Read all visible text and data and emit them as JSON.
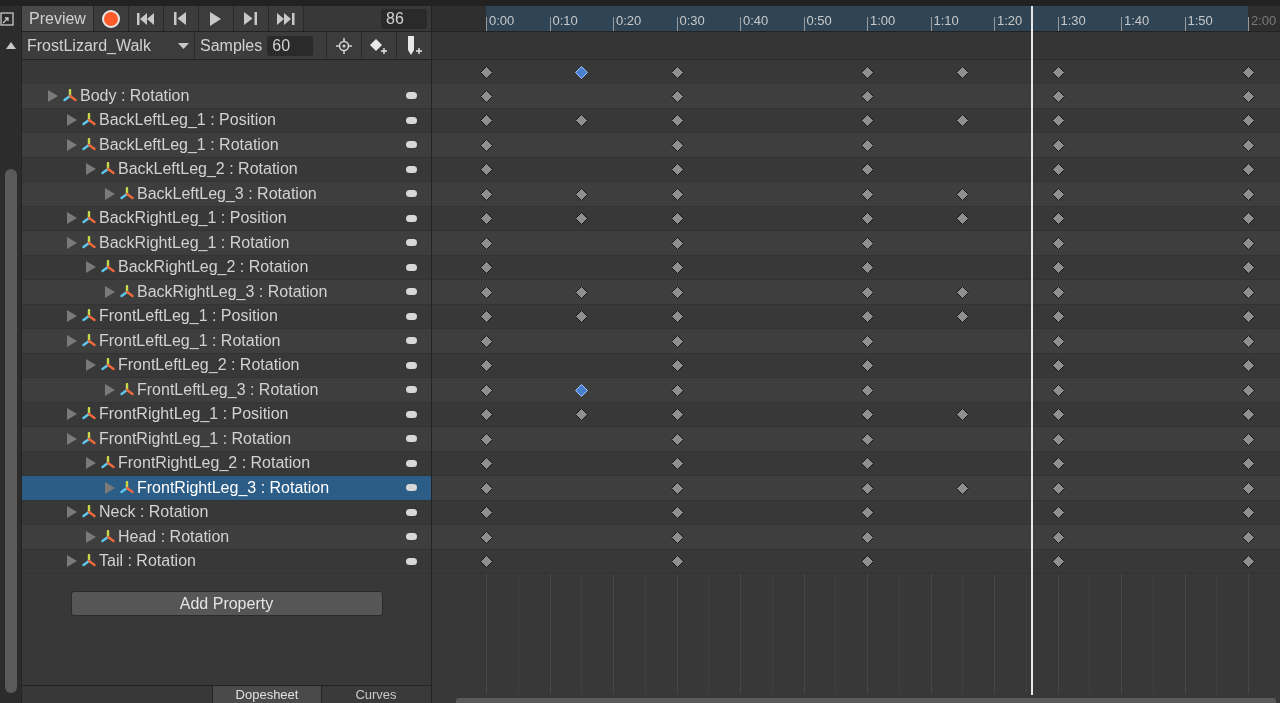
{
  "toolbar": {
    "preview": {
      "label": "Preview",
      "on": false
    },
    "record": {
      "on": false
    },
    "frame": "86"
  },
  "clip": {
    "name": "FrostLizard_Walk",
    "samples_label": "Samples",
    "samples": "60"
  },
  "ruler": [
    {
      "label": "0:00",
      "dimmed": false
    },
    {
      "label": "0:10",
      "dimmed": false
    },
    {
      "label": "0:20",
      "dimmed": false
    },
    {
      "label": "0:30",
      "dimmed": false
    },
    {
      "label": "0:40",
      "dimmed": false
    },
    {
      "label": "0:50",
      "dimmed": false
    },
    {
      "label": "1:00",
      "dimmed": false
    },
    {
      "label": "1:10",
      "dimmed": false
    },
    {
      "label": "1:20",
      "dimmed": false
    },
    {
      "label": "1:30",
      "dimmed": false
    },
    {
      "label": "1:40",
      "dimmed": false
    },
    {
      "label": "1:50",
      "dimmed": false
    },
    {
      "label": "2:00",
      "dimmed": true
    }
  ],
  "summary_keys": [
    {
      "keyed": true,
      "selected": false
    },
    {
      "keyed": true,
      "selected": true
    },
    {
      "keyed": true,
      "selected": false
    },
    {
      "keyed": true,
      "selected": false
    },
    {
      "keyed": true,
      "selected": false
    },
    {
      "keyed": true,
      "selected": false
    },
    {
      "keyed": true,
      "selected": false
    }
  ],
  "properties": [
    {
      "label": "Body : Rotation",
      "selected": false,
      "keys": [
        {
          "keyed": true,
          "selected": false
        },
        {
          "keyed": false
        },
        {
          "keyed": true,
          "selected": false
        },
        {
          "keyed": true,
          "selected": false
        },
        {
          "keyed": false
        },
        {
          "keyed": true,
          "selected": false
        },
        {
          "keyed": true,
          "selected": false
        }
      ],
      "children": [
        {
          "label": "BackLeftLeg_1 : Position",
          "selected": false,
          "keys": [
            {
              "keyed": true,
              "selected": false
            },
            {
              "keyed": true,
              "selected": false
            },
            {
              "keyed": true,
              "selected": false
            },
            {
              "keyed": true,
              "selected": false
            },
            {
              "keyed": true,
              "selected": false
            },
            {
              "keyed": true,
              "selected": false
            },
            {
              "keyed": true,
              "selected": false
            }
          ]
        },
        {
          "label": "BackLeftLeg_1 : Rotation",
          "selected": false,
          "keys": [
            {
              "keyed": true,
              "selected": false
            },
            {
              "keyed": false
            },
            {
              "keyed": true,
              "selected": false
            },
            {
              "keyed": true,
              "selected": false
            },
            {
              "keyed": false
            },
            {
              "keyed": true,
              "selected": false
            },
            {
              "keyed": true,
              "selected": false
            }
          ],
          "children": [
            {
              "label": "BackLeftLeg_2 : Rotation",
              "selected": false,
              "keys": [
                {
                  "keyed": true,
                  "selected": false
                },
                {
                  "keyed": false
                },
                {
                  "keyed": true,
                  "selected": false
                },
                {
                  "keyed": true,
                  "selected": false
                },
                {
                  "keyed": false
                },
                {
                  "keyed": true,
                  "selected": false
                },
                {
                  "keyed": true,
                  "selected": false
                }
              ],
              "children": [
                {
                  "label": "BackLeftLeg_3 : Rotation",
                  "selected": false,
                  "keys": [
                    {
                      "keyed": true,
                      "selected": false
                    },
                    {
                      "keyed": true,
                      "selected": false
                    },
                    {
                      "keyed": true,
                      "selected": false
                    },
                    {
                      "keyed": true,
                      "selected": false
                    },
                    {
                      "keyed": true,
                      "selected": false
                    },
                    {
                      "keyed": true,
                      "selected": false
                    },
                    {
                      "keyed": true,
                      "selected": false
                    }
                  ]
                }
              ]
            }
          ]
        },
        {
          "label": "BackRightLeg_1 : Position",
          "selected": false,
          "keys": [
            {
              "keyed": true,
              "selected": false
            },
            {
              "keyed": true,
              "selected": false
            },
            {
              "keyed": true,
              "selected": false
            },
            {
              "keyed": true,
              "selected": false
            },
            {
              "keyed": true,
              "selected": false
            },
            {
              "keyed": true,
              "selected": false
            },
            {
              "keyed": true,
              "selected": false
            }
          ]
        },
        {
          "label": "BackRightLeg_1 : Rotation",
          "selected": false,
          "keys": [
            {
              "keyed": true,
              "selected": false
            },
            {
              "keyed": false
            },
            {
              "keyed": true,
              "selected": false
            },
            {
              "keyed": true,
              "selected": false
            },
            {
              "keyed": false
            },
            {
              "keyed": true,
              "selected": false
            },
            {
              "keyed": true,
              "selected": false
            }
          ],
          "children": [
            {
              "label": "BackRightLeg_2 : Rotation",
              "selected": false,
              "keys": [
                {
                  "keyed": true,
                  "selected": false
                },
                {
                  "keyed": false
                },
                {
                  "keyed": true,
                  "selected": false
                },
                {
                  "keyed": true,
                  "selected": false
                },
                {
                  "keyed": false
                },
                {
                  "keyed": true,
                  "selected": false
                },
                {
                  "keyed": true,
                  "selected": false
                }
              ],
              "children": [
                {
                  "label": "BackRightLeg_3 : Rotation",
                  "selected": false,
                  "keys": [
                    {
                      "keyed": true,
                      "selected": false
                    },
                    {
                      "keyed": true,
                      "selected": false
                    },
                    {
                      "keyed": true,
                      "selected": false
                    },
                    {
                      "keyed": true,
                      "selected": false
                    },
                    {
                      "keyed": true,
                      "selected": false
                    },
                    {
                      "keyed": true,
                      "selected": false
                    },
                    {
                      "keyed": true,
                      "selected": false
                    }
                  ]
                }
              ]
            }
          ]
        },
        {
          "label": "FrontLeftLeg_1 : Position",
          "selected": false,
          "keys": [
            {
              "keyed": true,
              "selected": false
            },
            {
              "keyed": true,
              "selected": false
            },
            {
              "keyed": true,
              "selected": false
            },
            {
              "keyed": true,
              "selected": false
            },
            {
              "keyed": true,
              "selected": false
            },
            {
              "keyed": true,
              "selected": false
            },
            {
              "keyed": true,
              "selected": false
            }
          ]
        },
        {
          "label": "FrontLeftLeg_1 : Rotation",
          "selected": false,
          "keys": [
            {
              "keyed": true,
              "selected": false
            },
            {
              "keyed": false
            },
            {
              "keyed": true,
              "selected": false
            },
            {
              "keyed": true,
              "selected": false
            },
            {
              "keyed": false
            },
            {
              "keyed": true,
              "selected": false
            },
            {
              "keyed": true,
              "selected": false
            }
          ],
          "children": [
            {
              "label": "FrontLeftLeg_2 : Rotation",
              "selected": false,
              "keys": [
                {
                  "keyed": true,
                  "selected": false
                },
                {
                  "keyed": false
                },
                {
                  "keyed": true,
                  "selected": false
                },
                {
                  "keyed": true,
                  "selected": false
                },
                {
                  "keyed": false
                },
                {
                  "keyed": true,
                  "selected": false
                },
                {
                  "keyed": true,
                  "selected": false
                }
              ],
              "children": [
                {
                  "label": "FrontLeftLeg_3 : Rotation",
                  "selected": false,
                  "keys": [
                    {
                      "keyed": true,
                      "selected": false
                    },
                    {
                      "keyed": true,
                      "selected": true
                    },
                    {
                      "keyed": true,
                      "selected": false
                    },
                    {
                      "keyed": true,
                      "selected": false
                    },
                    {
                      "keyed": false
                    },
                    {
                      "keyed": true,
                      "selected": false
                    },
                    {
                      "keyed": true,
                      "selected": false
                    }
                  ]
                }
              ]
            }
          ]
        },
        {
          "label": "FrontRightLeg_1 : Position",
          "selected": false,
          "keys": [
            {
              "keyed": true,
              "selected": false
            },
            {
              "keyed": true,
              "selected": false
            },
            {
              "keyed": true,
              "selected": false
            },
            {
              "keyed": true,
              "selected": false
            },
            {
              "keyed": true,
              "selected": false
            },
            {
              "keyed": true,
              "selected": false
            },
            {
              "keyed": true,
              "selected": false
            }
          ]
        },
        {
          "label": "FrontRightLeg_1 : Rotation",
          "selected": false,
          "keys": [
            {
              "keyed": true,
              "selected": false
            },
            {
              "keyed": false
            },
            {
              "keyed": true,
              "selected": false
            },
            {
              "keyed": true,
              "selected": false
            },
            {
              "keyed": false
            },
            {
              "keyed": true,
              "selected": false
            },
            {
              "keyed": true,
              "selected": false
            }
          ],
          "children": [
            {
              "label": "FrontRightLeg_2 : Rotation",
              "selected": false,
              "keys": [
                {
                  "keyed": true,
                  "selected": false
                },
                {
                  "keyed": false
                },
                {
                  "keyed": true,
                  "selected": false
                },
                {
                  "keyed": true,
                  "selected": false
                },
                {
                  "keyed": false
                },
                {
                  "keyed": true,
                  "selected": false
                },
                {
                  "keyed": true,
                  "selected": false
                }
              ],
              "children": [
                {
                  "label": "FrontRightLeg_3 : Rotation",
                  "selected": true,
                  "keys": [
                    {
                      "keyed": true,
                      "selected": false
                    },
                    {
                      "keyed": false
                    },
                    {
                      "keyed": true,
                      "selected": false
                    },
                    {
                      "keyed": true,
                      "selected": false
                    },
                    {
                      "keyed": true,
                      "selected": false
                    },
                    {
                      "keyed": true,
                      "selected": false
                    },
                    {
                      "keyed": true,
                      "selected": false
                    }
                  ]
                }
              ]
            }
          ]
        },
        {
          "label": "Neck : Rotation",
          "selected": false,
          "keys": [
            {
              "keyed": true,
              "selected": false
            },
            {
              "keyed": false
            },
            {
              "keyed": true,
              "selected": false
            },
            {
              "keyed": true,
              "selected": false
            },
            {
              "keyed": false
            },
            {
              "keyed": true,
              "selected": false
            },
            {
              "keyed": true,
              "selected": false
            }
          ],
          "children": [
            {
              "label": "Head : Rotation",
              "selected": false,
              "keys": [
                {
                  "keyed": true,
                  "selected": false
                },
                {
                  "keyed": false
                },
                {
                  "keyed": true,
                  "selected": false
                },
                {
                  "keyed": true,
                  "selected": false
                },
                {
                  "keyed": false
                },
                {
                  "keyed": true,
                  "selected": false
                },
                {
                  "keyed": true,
                  "selected": false
                }
              ]
            }
          ]
        },
        {
          "label": "Tail : Rotation",
          "selected": false,
          "keys": [
            {
              "keyed": true,
              "selected": false
            },
            {
              "keyed": false
            },
            {
              "keyed": true,
              "selected": false
            },
            {
              "keyed": true,
              "selected": false
            },
            {
              "keyed": false
            },
            {
              "keyed": true,
              "selected": false
            },
            {
              "keyed": true,
              "selected": false
            }
          ]
        }
      ]
    }
  ],
  "add_property": "Add Property",
  "view_tabs": [
    {
      "label": "Dopesheet",
      "selected": true
    },
    {
      "label": "Curves",
      "selected": false
    }
  ]
}
